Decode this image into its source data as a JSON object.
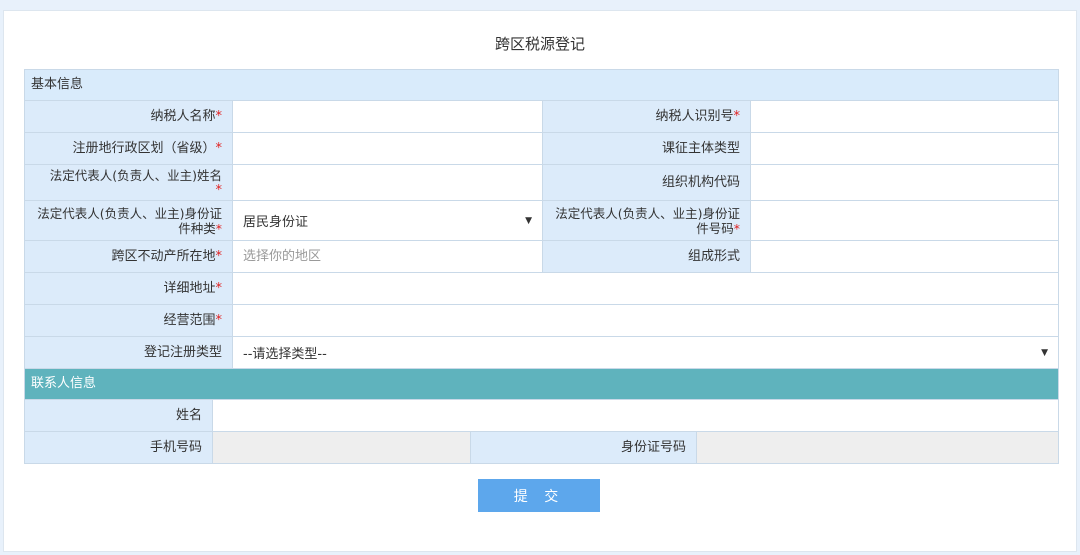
{
  "title": "跨区税源登记",
  "basic": {
    "heading": "基本信息",
    "taxpayer_name_label": "纳税人名称",
    "taxpayer_id_label": "纳税人识别号",
    "region_label": "注册地行政区划（省级）",
    "subject_type_label": "课征主体类型",
    "legal_rep_name_label": "法定代表人(负责人、业主)姓名",
    "org_code_label": "组织机构代码",
    "legal_rep_idtype_label": "法定代表人(负责人、业主)身份证件种类",
    "legal_rep_idtype_value": "居民身份证",
    "legal_rep_idno_label": "法定代表人(负责人、业主)身份证件号码",
    "property_location_label": "跨区不动产所在地",
    "property_location_placeholder": "选择你的地区",
    "composition_label": "组成形式",
    "address_label": "详细地址",
    "business_scope_label": "经营范围",
    "reg_type_label": "登记注册类型",
    "reg_type_value": "--请选择类型--"
  },
  "contact": {
    "heading": "联系人信息",
    "name_label": "姓名",
    "phone_label": "手机号码",
    "idcard_label": "身份证号码"
  },
  "required_mark": "*",
  "submit_label": "提 交",
  "colors": {
    "label_bg": "#dcebfa",
    "section_blue": "#d9ebfb",
    "section_teal": "#5fb3bd",
    "button": "#5da7ec",
    "required": "#e02020"
  }
}
